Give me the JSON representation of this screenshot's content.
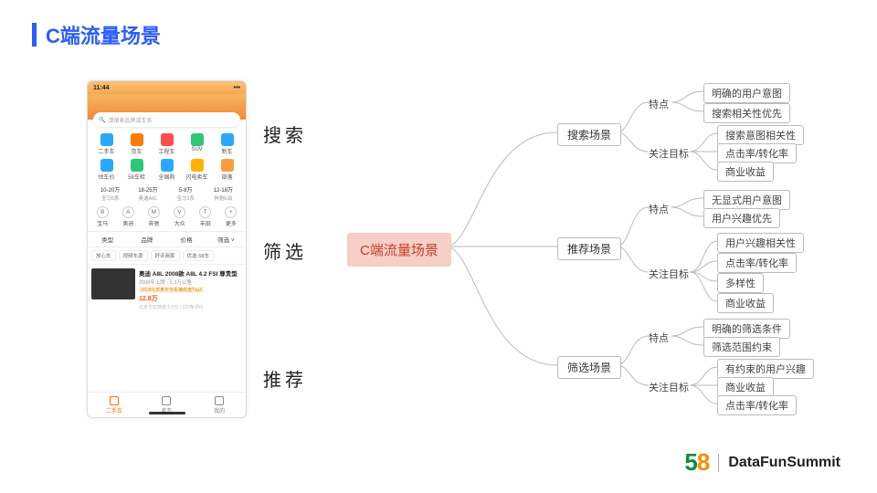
{
  "title": "C端流量场景",
  "side_labels": {
    "search": "搜索",
    "filter": "筛选",
    "recommend": "推荐"
  },
  "phone": {
    "time": "11:44",
    "signal": "•••",
    "search_placeholder": "请搜索品牌或车系",
    "icons_row1": [
      {
        "label": "二手车",
        "color": "#2aa8ff"
      },
      {
        "label": "货车",
        "color": "#ff7a00"
      },
      {
        "label": "工程车",
        "color": "#ff4d4d"
      },
      {
        "label": "SUV",
        "color": "#2ec77a"
      },
      {
        "label": "新车",
        "color": "#2aa8ff"
      }
    ],
    "icons_row2": [
      {
        "label": "估车价",
        "color": "#2aa8ff"
      },
      {
        "label": "58车检",
        "color": "#2ec77a"
      },
      {
        "label": "全国购",
        "color": "#2aa8ff"
      },
      {
        "label": "闪电卖车",
        "color": "#ffb300"
      },
      {
        "label": "部落",
        "color": "#ff9a3c"
      }
    ],
    "price_ranges": [
      {
        "top": "10-20万",
        "sub": "宝马5系"
      },
      {
        "top": "18-25万",
        "sub": "奥迪A6L"
      },
      {
        "top": "5-8万",
        "sub": "宝马3系"
      },
      {
        "top": "12-18万",
        "sub": "奔驰E级"
      }
    ],
    "brands": [
      {
        "label": "宝马",
        "g": "B"
      },
      {
        "label": "奥迪",
        "g": "A"
      },
      {
        "label": "奔驰",
        "g": "M"
      },
      {
        "label": "大众",
        "g": "V"
      },
      {
        "label": "丰田",
        "g": "T"
      },
      {
        "label": "更多",
        "g": "+"
      }
    ],
    "filter_tabs": [
      "类型",
      "品牌",
      "价格",
      "筛选 ˅"
    ],
    "chips": [
      "放心车",
      "视频车源",
      "好评商家",
      "优选·58车"
    ],
    "listing": {
      "title": "奥迪 A8L 2008款 A8L 4.2 FSI 尊贵型",
      "sub": "2008年上牌 · 9.3万公里",
      "tag": "2018北京某年份车辆底盘Top3",
      "price": "12.8万",
      "footer": "北京华宏锦途  5.0分 | 222条评价"
    },
    "tabbar": [
      "二手车",
      "卖车",
      "我的"
    ]
  },
  "mindmap": {
    "root": "C端流量场景",
    "branches": [
      {
        "name": "搜索场景",
        "groups": [
          {
            "label": "特点",
            "items": [
              "明确的用户意图",
              "搜索相关性优先"
            ]
          },
          {
            "label": "关注目标",
            "items": [
              "搜索意图相关性",
              "点击率/转化率",
              "商业收益"
            ]
          }
        ]
      },
      {
        "name": "推荐场景",
        "groups": [
          {
            "label": "特点",
            "items": [
              "无显式用户意图",
              "用户兴趣优先"
            ]
          },
          {
            "label": "关注目标",
            "items": [
              "用户兴趣相关性",
              "点击率/转化率",
              "多样性",
              "商业收益"
            ]
          }
        ]
      },
      {
        "name": "筛选场景",
        "groups": [
          {
            "label": "特点",
            "items": [
              "明确的筛选条件",
              "筛选范围约束"
            ]
          },
          {
            "label": "关注目标",
            "items": [
              "有约束的用户兴趣",
              "商业收益",
              "点击率/转化率"
            ]
          }
        ]
      }
    ]
  },
  "footer": {
    "brand": "DataFunSummit",
    "logo_a": "5",
    "logo_b": "8"
  }
}
